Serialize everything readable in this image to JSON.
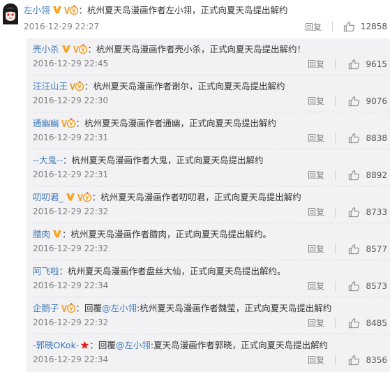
{
  "main_comment": {
    "user": "左小翎",
    "text": "：杭州夏天岛漫画作者左小翎，正式向夏天岛提出解约",
    "time": "2016-12-29 22:27",
    "reply_label": "回复",
    "likes": "12858",
    "badges": [
      "v-icon",
      "vip-icon"
    ]
  },
  "replies": [
    {
      "user": "壳小杀",
      "badges": [
        "v-icon",
        "vip-icon"
      ],
      "prefix": "",
      "mention": "",
      "text": "：杭州夏天岛漫画作者壳小杀，正式向夏天岛提出解约！",
      "time": "2016-12-29 22:45",
      "reply_label": "回复",
      "likes": "9615"
    },
    {
      "user": "汪汪山王",
      "badges": [
        "vip-icon"
      ],
      "prefix": "",
      "mention": "",
      "text": "：杭州夏天岛漫画作者谢尔，正式向夏天岛提出解约",
      "time": "2016-12-29 22:30",
      "reply_label": "回复",
      "likes": "9076"
    },
    {
      "user": "通幽幽",
      "badges": [
        "vip-icon"
      ],
      "prefix": "",
      "mention": "",
      "text": "：杭州夏天岛漫画作者通幽，正式向夏天岛提出解约",
      "time": "2016-12-29 22:31",
      "reply_label": "回复",
      "likes": "8838"
    },
    {
      "user": "--大鬼--",
      "badges": [],
      "prefix": "",
      "mention": "",
      "text": "：杭州夏天岛漫画作者大鬼，正式向夏天岛提出解约",
      "time": "2016-12-29 22:31",
      "reply_label": "回复",
      "likes": "8892"
    },
    {
      "user": "叨叨君_",
      "badges": [
        "v-icon",
        "vip-icon"
      ],
      "prefix": "",
      "mention": "",
      "text": "：杭州夏天岛漫画作者叨叨君，正式向夏天岛提出解约",
      "time": "2016-12-29 22:32",
      "reply_label": "回复",
      "likes": "8733"
    },
    {
      "user": "腊肉",
      "badges": [
        "v-icon"
      ],
      "prefix": "",
      "mention": "",
      "text": "：杭州夏天岛漫画作者腊肉，正式向夏天岛提出解约。",
      "time": "2016-12-29 22:32",
      "reply_label": "回复",
      "likes": "8577"
    },
    {
      "user": "阿飞啦",
      "badges": [],
      "prefix": "",
      "mention": "",
      "text": "：杭州夏天岛漫画作者盘丝大仙，正式向夏天岛提出解约。",
      "time": "2016-12-29 22:34",
      "reply_label": "回复",
      "likes": "8573"
    },
    {
      "user": "企鹅子",
      "badges": [
        "vip-icon"
      ],
      "prefix": "：回覆",
      "mention": "@左小翎",
      "text": ":杭州夏天岛漫画作者魏莹，正式向夏天岛提出解约",
      "time": "2016-12-29 22:32",
      "reply_label": "回复",
      "likes": "8485"
    },
    {
      "user": "-郭晓OKok-",
      "badges": [
        "star-icon"
      ],
      "prefix": "：回覆",
      "mention": "@左小翎",
      "text": ":夏天岛漫画作者郭晓，正式向夏天岛提出解约",
      "time": "2016-12-29 22:34",
      "reply_label": "回复",
      "likes": "8356"
    }
  ],
  "colors": {
    "link": "#3e78b7",
    "meta": "#808080",
    "verified": "#f5a623",
    "vip": "#f0a030",
    "star": "#e02020",
    "panel_bg": "#f2f2f5"
  }
}
